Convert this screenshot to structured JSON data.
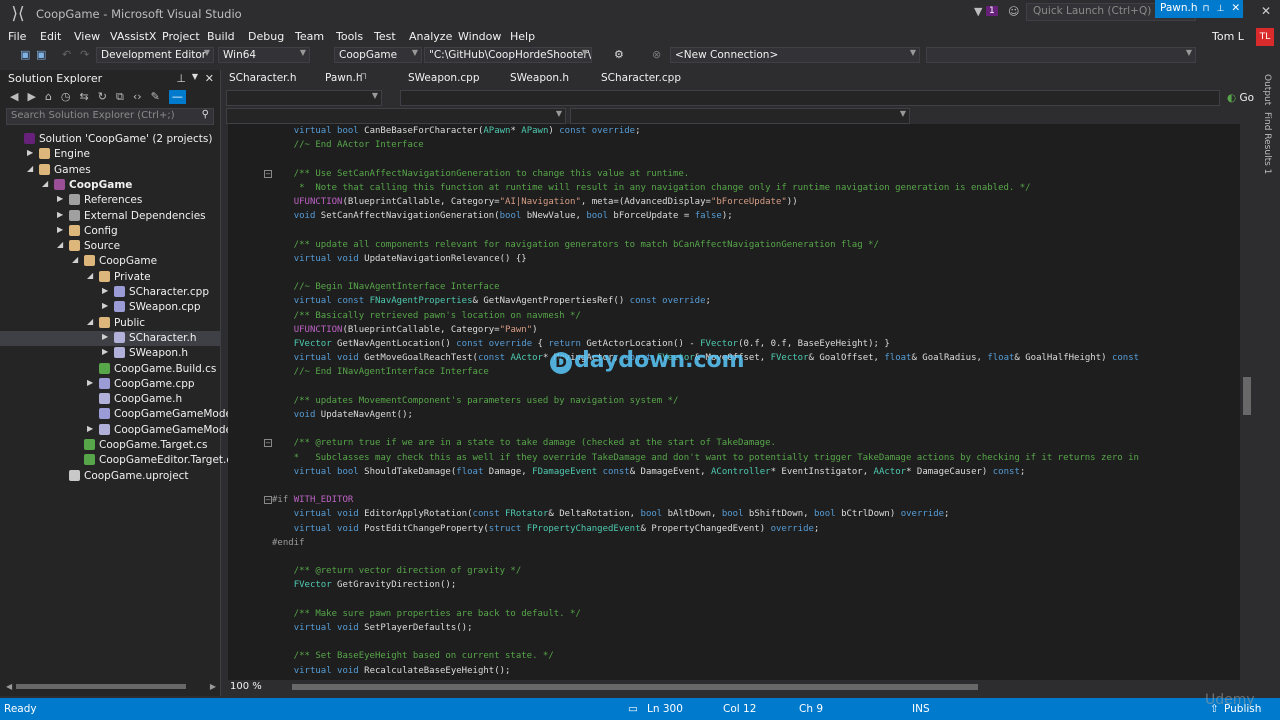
{
  "window": {
    "title": "CoopGame - Microsoft Visual Studio",
    "notif_count": "1",
    "quick_launch_placeholder": "Quick Launch (Ctrl+Q)",
    "user": "Tom L",
    "avatar": "TL"
  },
  "menu": [
    "File",
    "Edit",
    "View",
    "VAssistX",
    "Project",
    "Build",
    "Debug",
    "Team",
    "Tools",
    "Test",
    "Analyze",
    "Window",
    "Help"
  ],
  "toolbar": {
    "config": "Development Editor",
    "platform": "Win64",
    "project": "CoopGame",
    "path": "\"C:\\GitHub\\CoopHordeShooter\\Co",
    "connection": "<New Connection>"
  },
  "solution_explorer": {
    "title": "Solution Explorer",
    "search_placeholder": "Search Solution Explorer (Ctrl+;)",
    "items": [
      {
        "label": "Solution 'CoopGame' (2 projects)",
        "depth": 0,
        "arrow": "",
        "icon": "solution",
        "color": "#68217a"
      },
      {
        "label": "Engine",
        "depth": 1,
        "arrow": "▶",
        "icon": "folder",
        "color": "#dcb67a"
      },
      {
        "label": "Games",
        "depth": 1,
        "arrow": "◢",
        "icon": "folder",
        "color": "#dcb67a"
      },
      {
        "label": "CoopGame",
        "depth": 2,
        "arrow": "◢",
        "icon": "project",
        "color": "#9b4f96",
        "bold": true
      },
      {
        "label": "References",
        "depth": 3,
        "arrow": "▶",
        "icon": "refs",
        "color": "#a0a0a0"
      },
      {
        "label": "External Dependencies",
        "depth": 3,
        "arrow": "▶",
        "icon": "deps",
        "color": "#a0a0a0"
      },
      {
        "label": "Config",
        "depth": 3,
        "arrow": "▶",
        "icon": "folder",
        "color": "#dcb67a"
      },
      {
        "label": "Source",
        "depth": 3,
        "arrow": "◢",
        "icon": "folder",
        "color": "#dcb67a"
      },
      {
        "label": "CoopGame",
        "depth": 4,
        "arrow": "◢",
        "icon": "folder",
        "color": "#dcb67a"
      },
      {
        "label": "Private",
        "depth": 5,
        "arrow": "◢",
        "icon": "folder",
        "color": "#dcb67a"
      },
      {
        "label": "SCharacter.cpp",
        "depth": 6,
        "arrow": "▶",
        "icon": "cpp",
        "color": "#9b9bd6"
      },
      {
        "label": "SWeapon.cpp",
        "depth": 6,
        "arrow": "▶",
        "icon": "cpp",
        "color": "#9b9bd6"
      },
      {
        "label": "Public",
        "depth": 5,
        "arrow": "◢",
        "icon": "folder",
        "color": "#dcb67a"
      },
      {
        "label": "SCharacter.h",
        "depth": 6,
        "arrow": "▶",
        "icon": "h",
        "color": "#b0b0d8",
        "selected": true
      },
      {
        "label": "SWeapon.h",
        "depth": 6,
        "arrow": "▶",
        "icon": "h",
        "color": "#b0b0d8"
      },
      {
        "label": "CoopGame.Build.cs",
        "depth": 5,
        "arrow": "",
        "icon": "cs",
        "color": "#57a64a"
      },
      {
        "label": "CoopGame.cpp",
        "depth": 5,
        "arrow": "▶",
        "icon": "cpp",
        "color": "#9b9bd6"
      },
      {
        "label": "CoopGame.h",
        "depth": 5,
        "arrow": "",
        "icon": "h",
        "color": "#b0b0d8"
      },
      {
        "label": "CoopGameGameModeBa",
        "depth": 5,
        "arrow": "",
        "icon": "cpp",
        "color": "#9b9bd6"
      },
      {
        "label": "CoopGameGameModeBa",
        "depth": 5,
        "arrow": "▶",
        "icon": "h",
        "color": "#b0b0d8"
      },
      {
        "label": "CoopGame.Target.cs",
        "depth": 4,
        "arrow": "",
        "icon": "cs",
        "color": "#57a64a"
      },
      {
        "label": "CoopGameEditor.Target.cs",
        "depth": 4,
        "arrow": "",
        "icon": "cs",
        "color": "#57a64a"
      },
      {
        "label": "CoopGame.uproject",
        "depth": 3,
        "arrow": "",
        "icon": "file",
        "color": "#c8c8c8"
      }
    ]
  },
  "tabs": [
    "SCharacter.h",
    "Pawn.h",
    "SWeapon.cpp",
    "SWeapon.h",
    "SCharacter.cpp"
  ],
  "active_tab": "Pawn.h",
  "go_label": "Go",
  "code_lines": [
    {
      "t": "\tvirtual bool CanBeBaseForCharacter(APawn* APawn) const override;",
      "c": "code"
    },
    {
      "t": "\t//~ End AActor Interface",
      "c": "cm"
    },
    {
      "t": "",
      "c": "code"
    },
    {
      "t": "\t/** Use SetCanAffectNavigationGeneration to change this value at runtime.",
      "c": "cm",
      "fold": true
    },
    {
      "t": "\t *  Note that calling this function at runtime will result in any navigation change only if runtime navigation generation is enabled. */",
      "c": "cm"
    },
    {
      "t": "\tUFUNCTION(BlueprintCallable, Category=\"AI|Navigation\", meta=(AdvancedDisplay=\"bForceUpdate\"))",
      "c": "code"
    },
    {
      "t": "\tvoid SetCanAffectNavigationGeneration(bool bNewValue, bool bForceUpdate = false);",
      "c": "code"
    },
    {
      "t": "",
      "c": "code"
    },
    {
      "t": "\t/** update all components relevant for navigation generators to match bCanAffectNavigationGeneration flag */",
      "c": "cm"
    },
    {
      "t": "\tvirtual void UpdateNavigationRelevance() {}",
      "c": "code"
    },
    {
      "t": "",
      "c": "code"
    },
    {
      "t": "\t//~ Begin INavAgentInterface Interface",
      "c": "cm"
    },
    {
      "t": "\tvirtual const FNavAgentProperties& GetNavAgentPropertiesRef() const override;",
      "c": "code"
    },
    {
      "t": "\t/** Basically retrieved pawn's location on navmesh */",
      "c": "cm"
    },
    {
      "t": "\tUFUNCTION(BlueprintCallable, Category=\"Pawn\")",
      "c": "code"
    },
    {
      "t": "\tFVector GetNavAgentLocation() const override { return GetActorLocation() - FVector(0.f, 0.f, BaseEyeHeight); }",
      "c": "code"
    },
    {
      "t": "\tvirtual void GetMoveGoalReachTest(const AActor* MovingActor, const FVector& MoveOffset, FVector& GoalOffset, float& GoalRadius, float& GoalHalfHeight) const",
      "c": "code"
    },
    {
      "t": "\t//~ End INavAgentInterface Interface",
      "c": "cm"
    },
    {
      "t": "",
      "c": "code"
    },
    {
      "t": "\t/** updates MovementComponent's parameters used by navigation system */",
      "c": "cm"
    },
    {
      "t": "\tvoid UpdateNavAgent();",
      "c": "code"
    },
    {
      "t": "",
      "c": "code"
    },
    {
      "t": "\t/** @return true if we are in a state to take damage (checked at the start of TakeDamage.",
      "c": "cm",
      "fold": true
    },
    {
      "t": "\t*   Subclasses may check this as well if they override TakeDamage and don't want to potentially trigger TakeDamage actions by checking if it returns zero in",
      "c": "cm"
    },
    {
      "t": "\tvirtual bool ShouldTakeDamage(float Damage, FDamageEvent const& DamageEvent, AController* EventInstigator, AActor* DamageCauser) const;",
      "c": "code"
    },
    {
      "t": "",
      "c": "code"
    },
    {
      "t": "#if WITH_EDITOR",
      "c": "pp",
      "fold": true
    },
    {
      "t": "\tvirtual void EditorApplyRotation(const FRotator& DeltaRotation, bool bAltDown, bool bShiftDown, bool bCtrlDown) override;",
      "c": "code"
    },
    {
      "t": "\tvirtual void PostEditChangeProperty(struct FPropertyChangedEvent& PropertyChangedEvent) override;",
      "c": "code"
    },
    {
      "t": "#endif",
      "c": "pp"
    },
    {
      "t": "",
      "c": "code"
    },
    {
      "t": "\t/** @return vector direction of gravity */",
      "c": "cm"
    },
    {
      "t": "\tFVector GetGravityDirection();",
      "c": "code"
    },
    {
      "t": "",
      "c": "code"
    },
    {
      "t": "\t/** Make sure pawn properties are back to default. */",
      "c": "cm"
    },
    {
      "t": "\tvirtual void SetPlayerDefaults();",
      "c": "code"
    },
    {
      "t": "",
      "c": "code"
    },
    {
      "t": "\t/** Set BaseEyeHeight based on current state. */",
      "c": "cm"
    },
    {
      "t": "\tvirtual void RecalculateBaseEyeHeight();",
      "c": "code"
    }
  ],
  "zoom": "100 %",
  "status": {
    "left": "Ready",
    "line": "Ln 300",
    "col": "Col 12",
    "ch": "Ch 9",
    "mode": "INS",
    "publish": "Publish"
  },
  "side_panels": [
    "Output",
    "Find Results 1"
  ],
  "watermark": "daydown.com",
  "udemy": "Udemy",
  "colors": {
    "accent": "#007acc",
    "keyword": "#569cd6",
    "comment": "#57a64a",
    "type": "#4ec9b0",
    "string": "#d69d85",
    "macro": "#bd63c5",
    "func": "#dcdcaa"
  }
}
